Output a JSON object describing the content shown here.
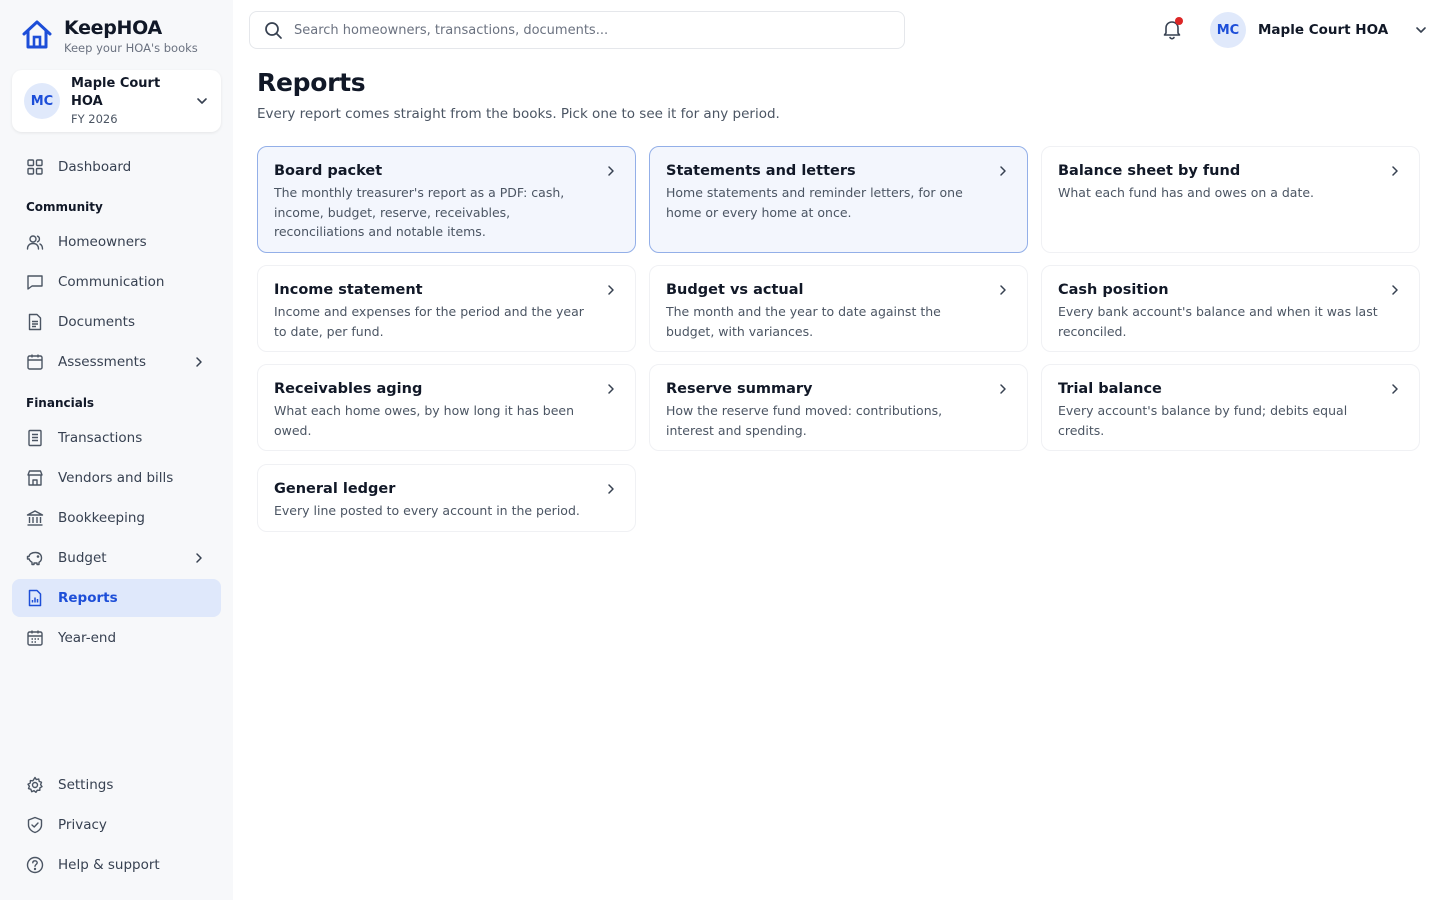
{
  "brand": {
    "name": "KeepHOA",
    "tagline": "Keep your HOA's books"
  },
  "org": {
    "initials": "MC",
    "name": "Maple Court HOA",
    "period": "FY 2026"
  },
  "nav": {
    "dashboard": "Dashboard",
    "community_label": "Community",
    "homeowners": "Homeowners",
    "communication": "Communication",
    "documents": "Documents",
    "assessments": "Assessments",
    "financials_label": "Financials",
    "transactions": "Transactions",
    "vendors": "Vendors and bills",
    "bookkeeping": "Bookkeeping",
    "budget": "Budget",
    "reports": "Reports",
    "yearend": "Year-end",
    "settings": "Settings",
    "privacy": "Privacy",
    "help": "Help & support"
  },
  "search": {
    "placeholder": "Search homeowners, transactions, documents..."
  },
  "user": {
    "initials": "MC",
    "name": "Maple Court HOA"
  },
  "page": {
    "title": "Reports",
    "subtitle": "Every report comes straight from the books. Pick one to see it for any period."
  },
  "reports": [
    {
      "title": "Board packet",
      "desc": "The monthly treasurer's report as a PDF: cash, income, budget, reserve, receivables, reconciliations and notable items."
    },
    {
      "title": "Statements and letters",
      "desc": "Home statements and reminder letters, for one home or every home at once."
    },
    {
      "title": "Balance sheet by fund",
      "desc": "What each fund has and owes on a date."
    },
    {
      "title": "Income statement",
      "desc": "Income and expenses for the period and the year to date, per fund."
    },
    {
      "title": "Budget vs actual",
      "desc": "The month and the year to date against the budget, with variances."
    },
    {
      "title": "Cash position",
      "desc": "Every bank account's balance and when it was last reconciled."
    },
    {
      "title": "Receivables aging",
      "desc": "What each home owes, by how long it has been owed."
    },
    {
      "title": "Reserve summary",
      "desc": "How the reserve fund moved: contributions, interest and spending."
    },
    {
      "title": "Trial balance",
      "desc": "Every account's balance by fund; debits equal credits."
    },
    {
      "title": "General ledger",
      "desc": "Every line posted to every account in the period."
    }
  ],
  "colors": {
    "accent": "#1d4ed8",
    "active_bg": "#dfe8fb",
    "notification_dot": "#dc2626"
  }
}
